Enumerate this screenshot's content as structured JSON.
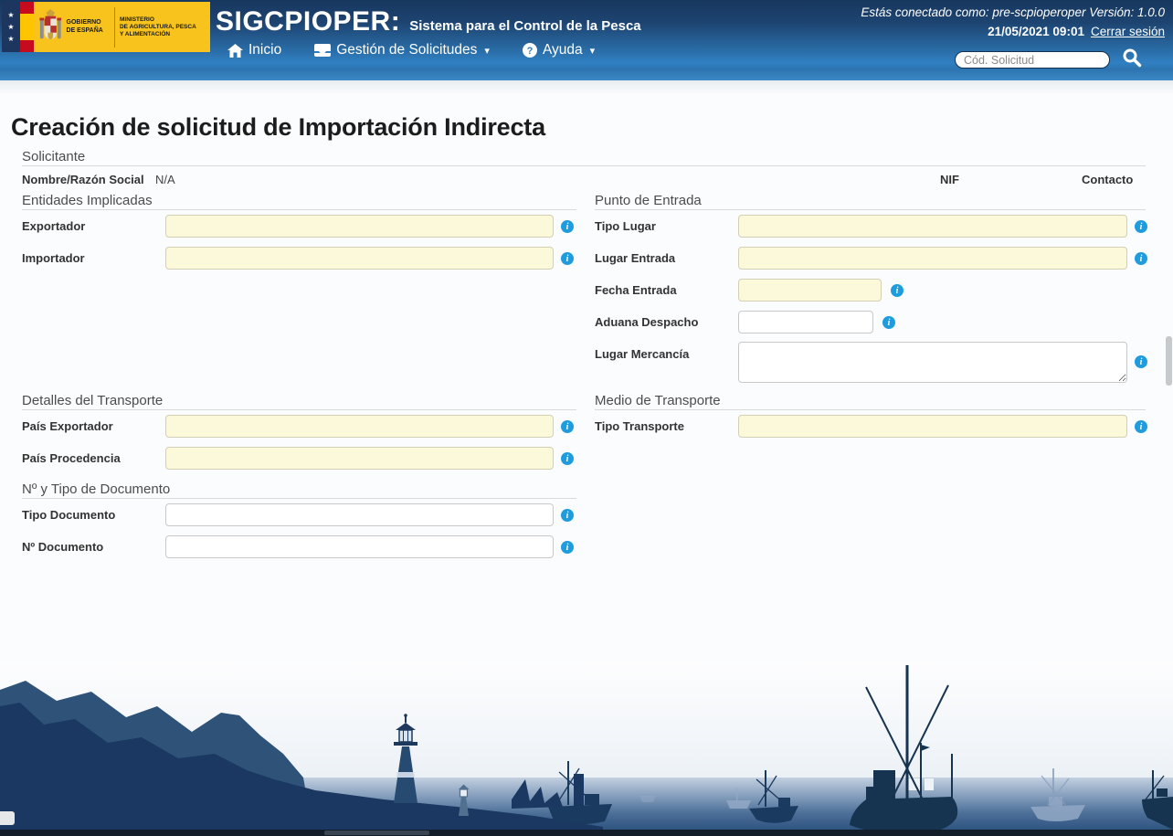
{
  "header": {
    "logo": {
      "gobierno_line1": "GOBIERNO",
      "gobierno_line2": "DE ESPAÑA",
      "ministerio_line1": "MINISTERIO",
      "ministerio_line2": "DE AGRICULTURA, PESCA",
      "ministerio_line3": "Y ALIMENTACIÓN"
    },
    "app_title": "SIGCPIOPER:",
    "app_subtitle": "Sistema para el Control de la Pesca",
    "session_text": "Estás conectado como: pre-scpioperoper Versión: 1.0.0",
    "datetime": "21/05/2021 09:01",
    "logout_label": "Cerrar sesión",
    "nav": [
      {
        "label": "Inicio"
      },
      {
        "label": "Gestión de Solicitudes"
      },
      {
        "label": "Ayuda"
      }
    ],
    "search": {
      "placeholder": "Cód. Solicitud",
      "value": ""
    }
  },
  "page": {
    "title": "Creación de solicitud de Importación Indirecta"
  },
  "solicitante": {
    "section_title": "Solicitante",
    "nombre_label": "Nombre/Razón Social",
    "nombre_value": "N/A",
    "nif_label": "NIF",
    "contacto_label": "Contacto"
  },
  "entidades": {
    "section_title": "Entidades Implicadas",
    "exportador_label": "Exportador",
    "exportador_value": "",
    "importador_label": "Importador",
    "importador_value": ""
  },
  "punto_entrada": {
    "section_title": "Punto de Entrada",
    "tipo_lugar_label": "Tipo Lugar",
    "tipo_lugar_value": "",
    "lugar_entrada_label": "Lugar Entrada",
    "lugar_entrada_value": "",
    "fecha_entrada_label": "Fecha Entrada",
    "fecha_entrada_value": "",
    "aduana_despacho_label": "Aduana Despacho",
    "aduana_despacho_value": "",
    "lugar_mercancia_label": "Lugar Mercancía",
    "lugar_mercancia_value": ""
  },
  "detalles_transporte": {
    "section_title": "Detalles del Transporte",
    "pais_exportador_label": "País Exportador",
    "pais_exportador_value": "",
    "pais_procedencia_label": "País Procedencia",
    "pais_procedencia_value": ""
  },
  "medio_transporte": {
    "section_title": "Medio de Transporte",
    "tipo_transporte_label": "Tipo Transporte",
    "tipo_transporte_value": ""
  },
  "documento": {
    "section_title": "Nº y Tipo de Documento",
    "tipo_documento_label": "Tipo Documento",
    "tipo_documento_value": "",
    "num_documento_label": "Nº Documento",
    "num_documento_value": ""
  },
  "icons": {
    "star": "★",
    "caret_down": "▾",
    "help_glyph": "?",
    "info_glyph": "i"
  },
  "colors": {
    "header_top": "#17375E",
    "header_bottom": "#3080C2",
    "required_field_bg": "#FBF9DA",
    "info_icon_blue": "#1F9CDE",
    "logo_yellow": "#F7C31C",
    "silhouette_dark": "#16334F",
    "silhouette_mid": "#1B3A60",
    "silhouette_light": "#2E5278"
  }
}
